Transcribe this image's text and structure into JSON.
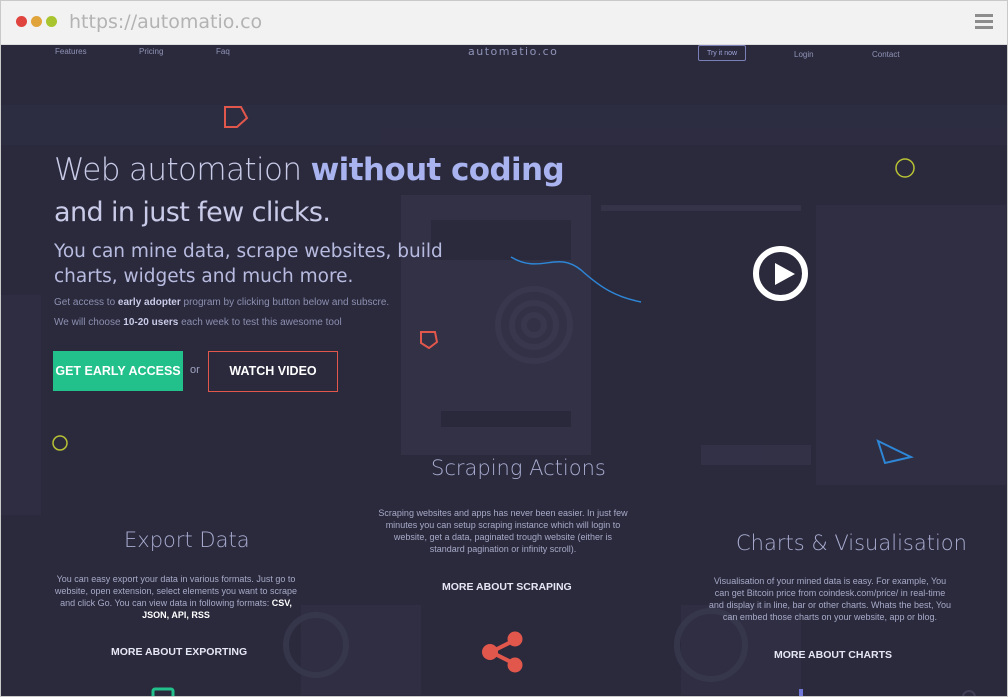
{
  "browser": {
    "url": "https://automatio.co",
    "dots": [
      "#e0443e",
      "#e0a43a",
      "#a8c42f"
    ]
  },
  "nav": {
    "left": [
      "Features",
      "Pricing",
      "Faq"
    ],
    "logo": "automatio.co",
    "try_label": "Try it now",
    "login_label": "Login",
    "contact_label": "Contact"
  },
  "hero": {
    "title_a": "Web automation ",
    "title_b": "without coding",
    "title_c": "and in just few clicks.",
    "subtitle": "You can mine data, scrape websites, build charts, widgets and much more.",
    "line1_a": "Get access to ",
    "line1_b": "early adopter",
    "line1_c": " program by clicking button below and subscre.",
    "line2_a": "We will choose ",
    "line2_b": "10-20 users",
    "line2_c": " each week to test this awesome tool",
    "cta_label": "GET  EARLY ACCESS",
    "or_label": "or",
    "video_label": "WATCH VIDEO"
  },
  "sections": {
    "scraping": {
      "title": "Scraping Actions",
      "text": "Scraping websites and apps has never been easier. In just few minutes you can setup scraping instance which will login to website, get a data, paginated trough website (either is standard pagination or infinity scroll).",
      "link": "MORE ABOUT SCRAPING"
    },
    "export": {
      "title": "Export Data",
      "text_a": "You can easy export your data in various formats. Just go to website, open extension, select elements you want to scrape and click Go. You can view data in following formats: ",
      "text_b": "CSV, JSON, API, RSS",
      "link": "MORE ABOUT EXPORTING"
    },
    "charts": {
      "title": "Charts & Visualisation",
      "text": "Visualisation of your mined data is easy. For example, You can get Bitcoin price from coindesk.com/price/ in real-time and display it in line, bar or other charts. Whats the best, You can embed those charts on your website, app or blog.",
      "link": "MORE ABOUT CHARTS"
    }
  },
  "colors": {
    "background": "#2b2a3d",
    "accent_green": "#22c08a",
    "accent_red": "#e2574c",
    "accent_yellow": "#b8c234",
    "accent_blue": "#2e86d6"
  }
}
